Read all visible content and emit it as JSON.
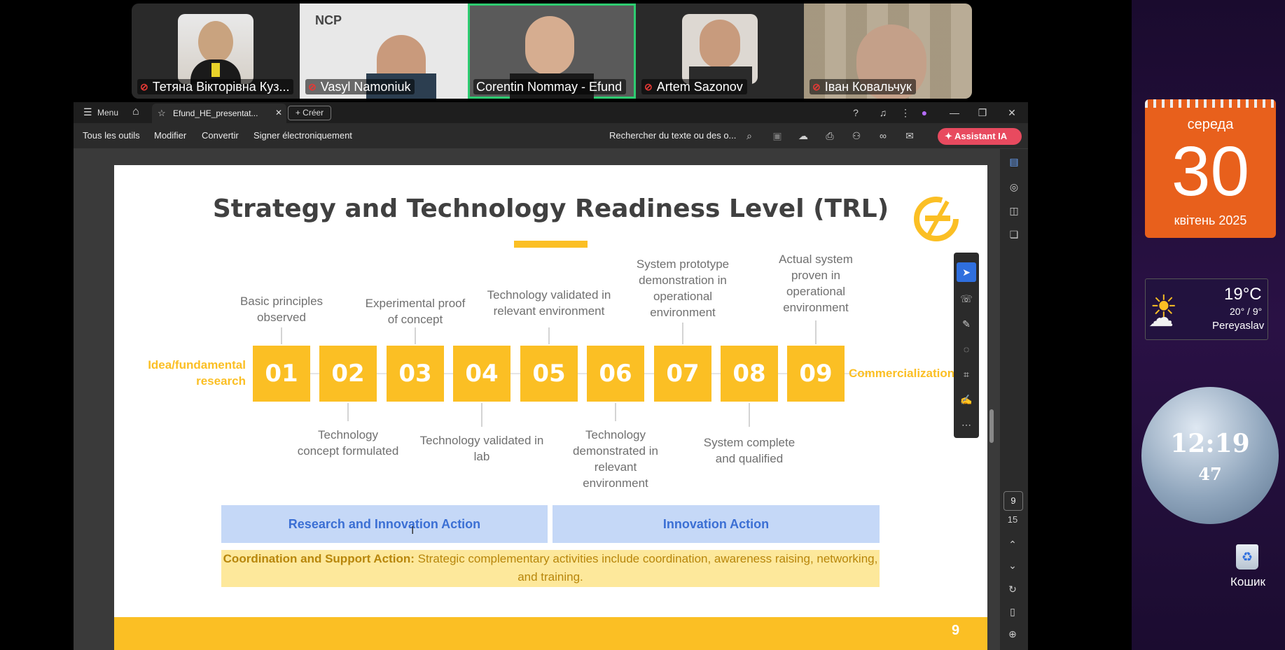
{
  "participants": [
    {
      "name": "Тетяна Вікторівна Куз...",
      "muted": true,
      "active": false
    },
    {
      "name": "Vasyl Namoniuk",
      "muted": true,
      "active": false,
      "bg_logo": "NCP"
    },
    {
      "name": "Corentin Nommay - Efund",
      "muted": false,
      "active": true
    },
    {
      "name": "Artem Sazonov",
      "muted": true,
      "active": false
    },
    {
      "name": "Іван Ковальчук",
      "muted": true,
      "active": false
    }
  ],
  "titlebar": {
    "menu_label": "Menu",
    "tab_title": "Efund_HE_presentat...",
    "new_button": "Créer"
  },
  "toolbar": {
    "items": [
      "Tous les outils",
      "Modifier",
      "Convertir",
      "Signer électroniquement"
    ],
    "search_placeholder": "Rechercher du texte ou des o...",
    "assistant_label": "Assistant IA"
  },
  "slide": {
    "title": "Strategy and Technology Readiness Level (TRL)",
    "left_label": "Idea/fundamental research",
    "right_label": "Commercialization",
    "levels": [
      {
        "num": "01",
        "label": "Basic principles observed",
        "pos": "top"
      },
      {
        "num": "02",
        "label": "Technology concept formulated",
        "pos": "bottom"
      },
      {
        "num": "03",
        "label": "Experimental proof of concept",
        "pos": "top"
      },
      {
        "num": "04",
        "label": "Technology validated in lab",
        "pos": "bottom"
      },
      {
        "num": "05",
        "label": "Technology validated in relevant environment",
        "pos": "top"
      },
      {
        "num": "06",
        "label": "Technology demonstrated in relevant environment",
        "pos": "bottom"
      },
      {
        "num": "07",
        "label": "System prototype demonstration in operational environment",
        "pos": "top"
      },
      {
        "num": "08",
        "label": "System complete and qualified",
        "pos": "bottom"
      },
      {
        "num": "09",
        "label": "Actual system proven in operational environment",
        "pos": "top"
      }
    ],
    "ria_label": "Research and Innovation Action",
    "ia_label": "Innovation Action",
    "csa_bold": "Coordination and Support Action:",
    "csa_text": " Strategic complementary activities include coordination, awareness raising, networking, and training.",
    "page_number": "9"
  },
  "pager": {
    "current": "9",
    "total": "15"
  },
  "calendar": {
    "weekday": "середа",
    "day": "30",
    "month_year": "квітень 2025"
  },
  "weather": {
    "temp": "19°C",
    "range": "20° / 9°",
    "city": "Pereyaslav"
  },
  "clock": {
    "time": "12:19",
    "seconds": "47"
  },
  "recycle_bin": {
    "label": "Кошик"
  },
  "colors": {
    "accent_yellow": "#fbbf24",
    "blue_band": "#c5d8f7",
    "blue_text": "#3b6fd4",
    "active_green": "#2ecc71",
    "assistant": "#e84a5f"
  }
}
